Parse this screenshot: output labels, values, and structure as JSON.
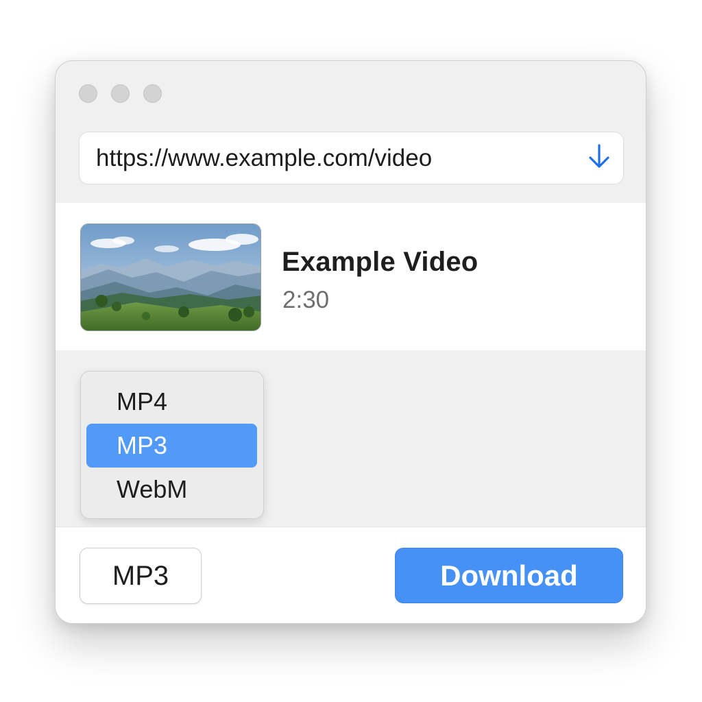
{
  "window": {
    "controls": [
      "close",
      "minimize",
      "zoom"
    ]
  },
  "url_bar": {
    "value": "https://www.example.com/video",
    "download_icon": "arrow-down-icon",
    "accent_color": "#1f6fe5"
  },
  "video": {
    "title": "Example Video",
    "duration": "2:30",
    "thumbnail_description": "mountain-landscape"
  },
  "format_menu": {
    "options": [
      {
        "label": "MP4",
        "selected": false
      },
      {
        "label": "MP3",
        "selected": true
      },
      {
        "label": "WebM",
        "selected": false
      }
    ],
    "highlight_color": "#519af7"
  },
  "footer": {
    "selected_format": "MP3",
    "download_label": "Download",
    "download_color": "#4691f6"
  }
}
